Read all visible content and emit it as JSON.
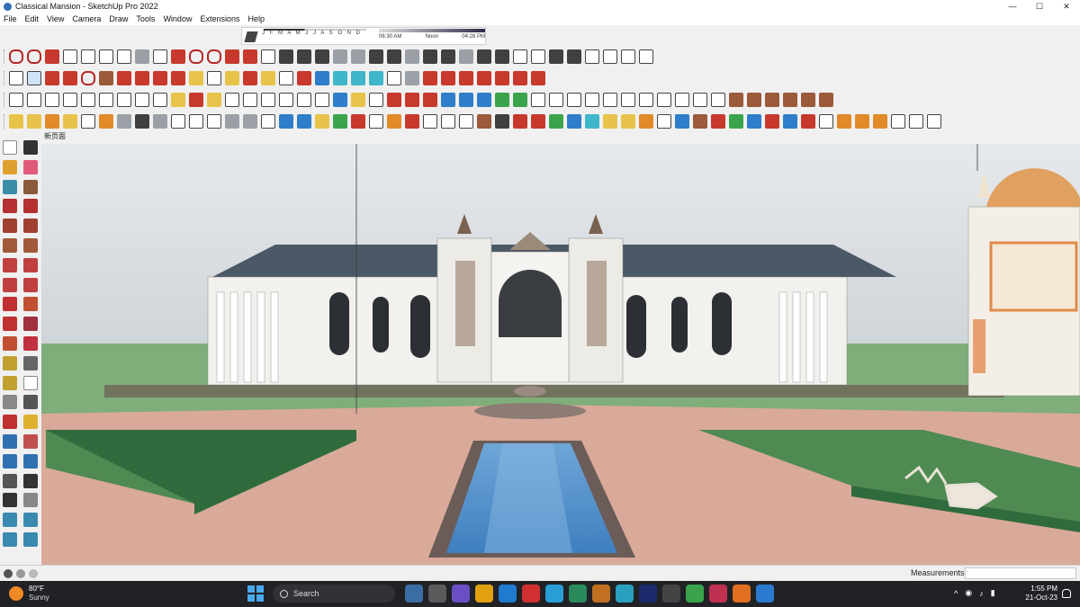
{
  "window": {
    "title": "Classical Mansion - SketchUp Pro 2022",
    "controls": [
      "—",
      "☐",
      "✕"
    ]
  },
  "menu": [
    "File",
    "Edit",
    "View",
    "Camera",
    "Draw",
    "Tools",
    "Window",
    "Extensions",
    "Help"
  ],
  "shadows": {
    "months": "J F M A M J J A S O N D",
    "time_start": "06:30 AM",
    "time_mid": "Noon",
    "time_end": "04:28 PM"
  },
  "scene_tab": "新页面",
  "statusbar": {
    "measurements_label": "Measurements",
    "measurements_value": ""
  },
  "taskbar": {
    "weather_temp": "80°F",
    "weather_condition": "Sunny",
    "search_placeholder": "Search",
    "time": "1:55 PM",
    "date": "21-Oct-23",
    "tray_chevron": "^"
  },
  "colors": {
    "sky": "#d8dce0",
    "grass": "#4f8a52",
    "hedge": "#2f6b3c",
    "water": "#4f8cc8",
    "paving": "#d9a99a",
    "roof": "#4b5866",
    "taskbar": "#202226"
  }
}
